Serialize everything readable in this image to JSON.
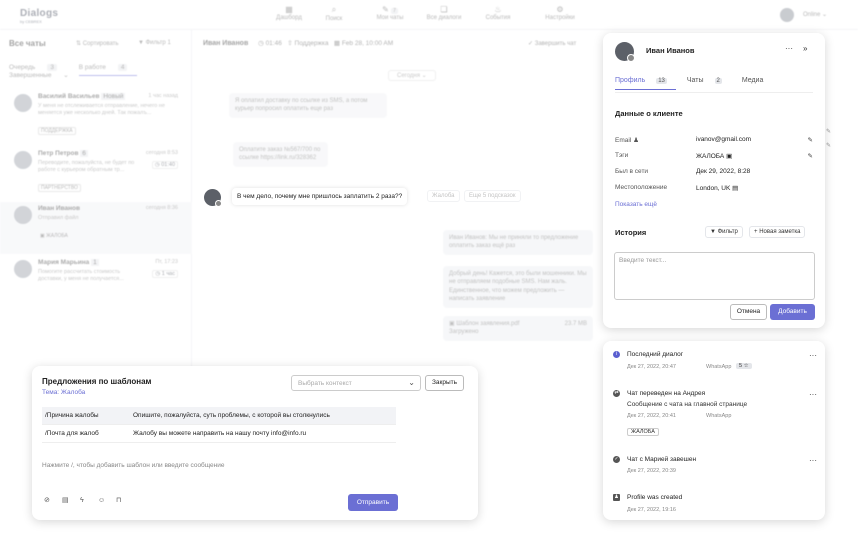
{
  "topbar": {
    "logo": "Dialogs",
    "logo_sub": "by CEBREX",
    "nav": [
      {
        "label": "Дашборд",
        "icon": "dashboard-icon",
        "count": ""
      },
      {
        "label": "Поиск",
        "icon": "search-icon",
        "count": ""
      },
      {
        "label": "Мои чаты",
        "icon": "chat-icon",
        "count": "7"
      },
      {
        "label": "Все диалоги",
        "icon": "dialogs-icon",
        "count": ""
      },
      {
        "label": "События",
        "icon": "events-icon",
        "count": ""
      },
      {
        "label": "Настройки",
        "icon": "settings-icon",
        "count": ""
      }
    ],
    "status": "Online"
  },
  "left": {
    "title": "Все чаты",
    "sort": "Сортировать",
    "filter": "Фильтр",
    "filter_count": "1",
    "tabs": [
      {
        "label": "Очередь",
        "count": "3"
      },
      {
        "label": "В работе",
        "count": "4"
      },
      {
        "label": "Завершенные",
        "count": ""
      }
    ],
    "conversations": [
      {
        "name": "Василий Васильев",
        "badge": "Новый",
        "time": "1 час назад",
        "msg": "У меня не отслеживается отправление, нечего не меняется уже несколько дней. Так пожалъ...",
        "tag": "ПОДДЕРЖКА"
      },
      {
        "name": "Петр Петров",
        "badge": "6",
        "time": "сегодня 8:53",
        "msg": "Переводите, пожалуйста, не будет по работе с курьером обратным тр...",
        "tag": "ПАРТНЕРСТВО",
        "timer": "01:40"
      },
      {
        "name": "Иван Иванов",
        "badge": "",
        "time": "сегодня 8:36",
        "msg": "Отправил файл",
        "tag": "ЖАЛОБА"
      },
      {
        "name": "Мария Марьина",
        "badge": "1",
        "time": "Пт, 17:23",
        "msg": "Помогите рассчитать стоимость доставки, у меня не получается...",
        "tag": "",
        "timer": "1 час"
      }
    ]
  },
  "chat": {
    "name": "Иван Иванов",
    "timer": "01:46",
    "department": "Поддержка",
    "date": "Feb 28, 10:00 AM",
    "finish": "Завершить чат",
    "day_divider": "Сегодня",
    "bubbles": [
      "Я оплатил доставку по ссылке из SMS, а потом курьер попросил оплатить еще раз",
      "Оплатите заказ №567/700 по ссылке https://link.ru/328362",
      "Иван Иванов: Мы не приняли то предложение оплатить заказ ещё раз",
      "Добрый день! Кажется, это были мошенники. Мы не отправляем подобные SMS. Нам жаль. Единственное, что можем предложить — написать заявление",
      "Шаблон заявления.pdf",
      "Загружено"
    ],
    "file_size": "23.7 MB",
    "main_message": "В чем дело, почему мне пришлось заплатить 2 раза??",
    "quick_replies": [
      "Жалоба",
      "Еще 5 подсказок"
    ]
  },
  "templates": {
    "title": "Предложения по шаблонам",
    "subject": "Тема: Жалоба",
    "context_placeholder": "Выбрать контекст",
    "close": "Закрыть",
    "rows": [
      {
        "key": "/Причина жалобы",
        "text": "Опишите, пожалуйста, суть проблемы, с которой вы столкнулись"
      },
      {
        "key": "/Почта для жалоб",
        "text": "Жалобу вы можете направить на нашу почту info@info.ru"
      }
    ],
    "hint": "Нажмите /, чтобы добавить шаблон или введите сообщение",
    "tools": [
      "paperclip-icon",
      "archive-icon",
      "bolt-icon",
      "smile-icon",
      "bookmark-icon"
    ],
    "send": "Отправить"
  },
  "profile": {
    "name": "Иван Иванов",
    "tabs": [
      {
        "label": "Профиль",
        "count": "13"
      },
      {
        "label": "Чаты",
        "count": "2"
      },
      {
        "label": "Медиа",
        "count": ""
      }
    ],
    "section": "Данные о клиенте",
    "fields": [
      {
        "label": "Email",
        "value": "ivanov@gmail.com"
      },
      {
        "label": "Тэги",
        "value": "ЖАЛОБА"
      },
      {
        "label": "Был в сети",
        "value": "Дек 29, 2022, 8:28"
      },
      {
        "label": "Местоположение",
        "value": "London, UK"
      }
    ],
    "show_more": "Показать ещё",
    "history_title": "История",
    "filter": "Фильтр",
    "new_note": "Новая заметка",
    "note_placeholder": "Введите текст...",
    "cancel": "Отмена",
    "add": "Добавить"
  },
  "history": [
    {
      "title": "Последний диалог",
      "date": "Дек 27, 2022, 20:47",
      "channel": "WhatsApp",
      "rating": "5 ☆"
    },
    {
      "title": "Чат переведен на Андрея",
      "sub": "Сообщение с чата на главной странице",
      "date": "Дек 27, 2022, 20:41",
      "channel": "WhatsApp",
      "tag": "ЖАЛОБА"
    },
    {
      "title": "Чат с Марией завешен",
      "date": "Дек 27, 2022, 20:39"
    },
    {
      "title": "Profile was created",
      "date": "Дек 27, 2022, 19:16"
    }
  ]
}
